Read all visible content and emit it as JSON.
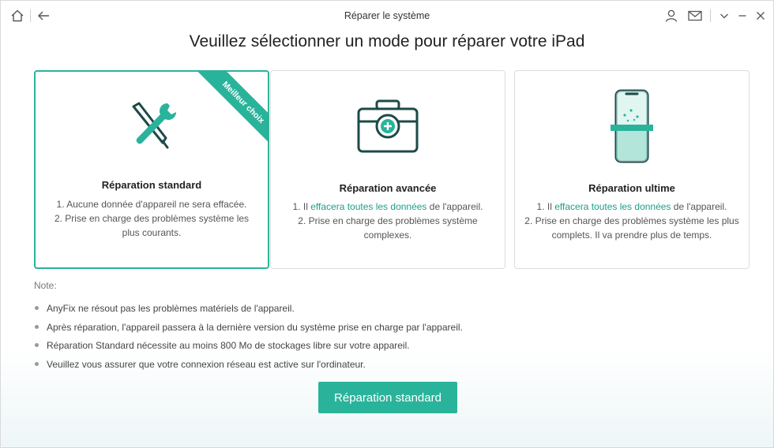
{
  "window": {
    "title": "Réparer le système"
  },
  "heading": "Veuillez sélectionner un mode pour réparer votre iPad",
  "cards": [
    {
      "title": "Réparation standard",
      "badge": "Meilleur choix",
      "line1": "1. Aucune donnée d'appareil ne sera effacée.",
      "line2": "2. Prise en charge des problèmes système les plus courants.",
      "icon": "tools-icon",
      "selected": true
    },
    {
      "title": "Réparation avancée",
      "line1_pre": "1. Il ",
      "line1_hl": "effacera toutes les données",
      "line1_post": " de l'appareil.",
      "line2": "2. Prise en charge des problèmes système complexes.",
      "icon": "toolbox-icon"
    },
    {
      "title": "Réparation ultime",
      "line1_pre": "1. Il ",
      "line1_hl": "effacera toutes les données",
      "line1_post": " de l'appareil.",
      "line2": "2. Prise en charge des problèmes système les plus complets. Il va prendre plus de temps.",
      "icon": "phone-scan-icon"
    }
  ],
  "note": {
    "label": "Note:",
    "items": [
      "AnyFix ne résout pas les problèmes matériels de l'appareil.",
      "Après réparation, l'appareil passera à la dernière version du système prise en charge par l'appareil.",
      "Réparation Standard nécessite au moins 800 Mo de stockages libre sur votre appareil.",
      "Veuillez vous assurer que votre connexion réseau est active sur l'ordinateur."
    ]
  },
  "primary_button": "Réparation standard",
  "colors": {
    "accent": "#2ab39b",
    "dark": "#1d4a48",
    "highlight": "#1a9f88"
  }
}
